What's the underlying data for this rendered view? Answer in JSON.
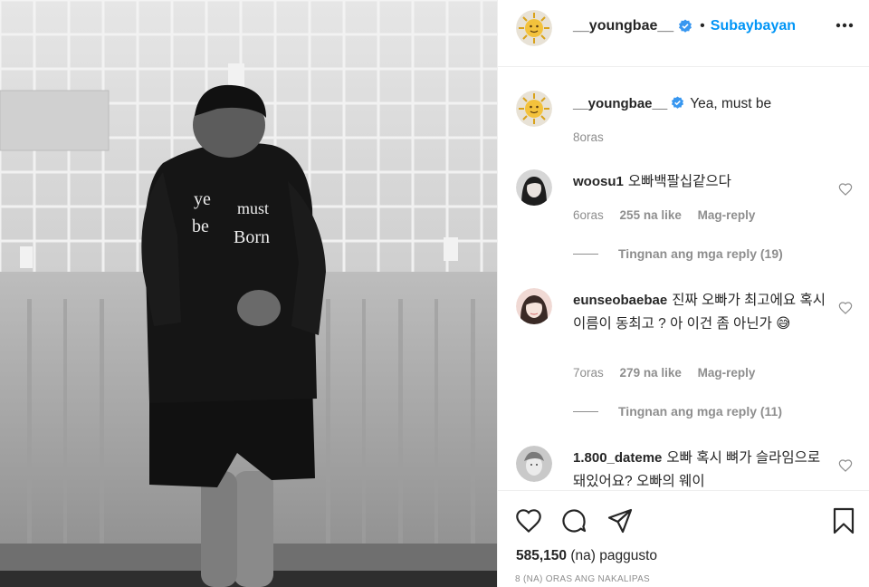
{
  "post": {
    "author": "__youngbae__",
    "follow_label": "Subaybayan",
    "dot": "•",
    "caption": "Yea, must be",
    "caption_time": "8oras",
    "likes_count": "585,150",
    "likes_suffix": "(na) paggusto",
    "time_ago": "8 (NA) ORAS ANG NAKALIPAS",
    "hoodie_text": [
      "ye",
      "must",
      "be",
      "Born"
    ]
  },
  "comments": [
    {
      "username": "woosu1",
      "text": "오빠백팔십같으다",
      "time": "6oras",
      "likes": "255 na like",
      "reply_label": "Mag-reply",
      "view_replies": "Tingnan ang mga reply (19)"
    },
    {
      "username": "eunseobaebae",
      "text": "진짜 오빠가 최고에요 혹시 이름이 동최고 ? 아 이건 좀 아닌가 😅",
      "time": "7oras",
      "likes": "279 na like",
      "reply_label": "Mag-reply",
      "view_replies": "Tingnan ang mga reply (11)"
    },
    {
      "username": "1.800_dateme",
      "text": "오빠 혹시 뼈가 슬라임으로 돼있어요? 오빠의 웨이"
    }
  ],
  "colors": {
    "accent": "#0095f6",
    "verified": "#3897f0",
    "muted": "#8e8e8e",
    "text": "#262626"
  },
  "icons": [
    "more-options-icon",
    "verified-badge-icon",
    "heart-icon",
    "comment-icon",
    "share-icon",
    "bookmark-icon"
  ]
}
